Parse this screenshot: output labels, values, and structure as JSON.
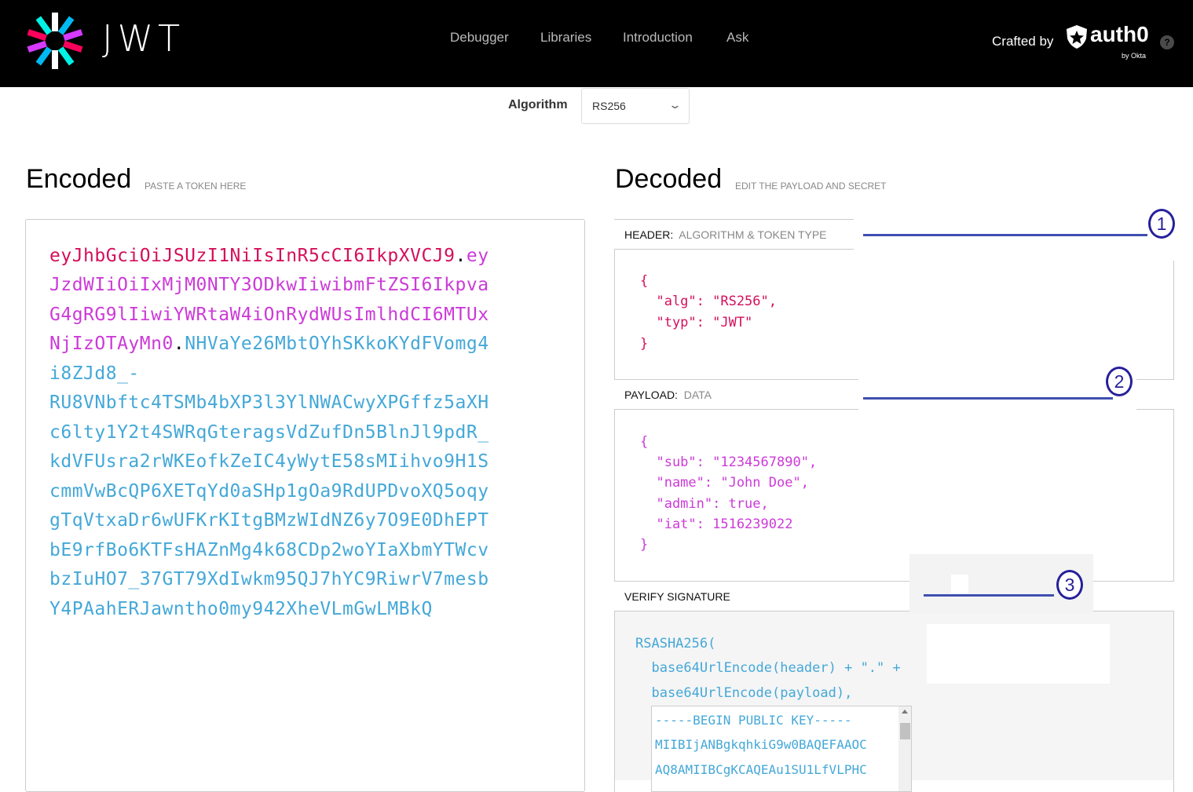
{
  "header": {
    "logo_text": "JWT",
    "nav": [
      "Debugger",
      "Libraries",
      "Introduction",
      "Ask"
    ],
    "crafted_by": "Crafted by",
    "brand_word": "auth0",
    "brand_sub": "by Okta",
    "help": "?"
  },
  "algorithm": {
    "label": "Algorithm",
    "value": "RS256"
  },
  "encoded": {
    "title": "Encoded",
    "subtitle": "PASTE A TOKEN HERE",
    "token_lines": [
      [
        {
          "t": "eyJhbGciOiJSUzI1NiIsInR5cCI6IkpXVCJ9",
          "c": "red"
        },
        {
          "t": ".",
          "c": "dot"
        },
        {
          "t": "ey",
          "c": "pur"
        }
      ],
      [
        {
          "t": "JzdWIiOiIxMjM0NTY3ODkwIiwibmFtZSI6Ikpva",
          "c": "pur"
        }
      ],
      [
        {
          "t": "G4gRG9lIiwiYWRtaW4iOnRydWUsImlhdCI6MTUx",
          "c": "pur"
        }
      ],
      [
        {
          "t": "NjIzOTAyMn0",
          "c": "pur"
        },
        {
          "t": ".",
          "c": "dot"
        },
        {
          "t": "NHVaYe26MbtOYhSKkoKYdFVomg4",
          "c": "blu"
        }
      ],
      [
        {
          "t": "i8ZJd8_-",
          "c": "blu"
        }
      ],
      [
        {
          "t": "RU8VNbftc4TSMb4bXP3l3YlNWACwyXPGffz5aXH",
          "c": "blu"
        }
      ],
      [
        {
          "t": "c6lty1Y2t4SWRqGteragsVdZufDn5BlnJl9pdR_",
          "c": "blu"
        }
      ],
      [
        {
          "t": "kdVFUsra2rWKEofkZeIC4yWytE58sMIihvo9H1S",
          "c": "blu"
        }
      ],
      [
        {
          "t": "cmmVwBcQP6XETqYd0aSHp1gOa9RdUPDvoXQ5oqy",
          "c": "blu"
        }
      ],
      [
        {
          "t": "gTqVtxaDr6wUFKrKItgBMzWIdNZ6y7O9E0DhEPT",
          "c": "blu"
        }
      ],
      [
        {
          "t": "bE9rfBo6KTFsHAZnMg4k68CDp2woYIaXbmYTWcv",
          "c": "blu"
        }
      ],
      [
        {
          "t": "bzIuHO7_37GT79XdIwkm95QJ7hYC9RiwrV7mesb",
          "c": "blu"
        }
      ],
      [
        {
          "t": "Y4PAahERJawntho0my942XheVLmGwLMBkQ",
          "c": "blu"
        }
      ]
    ]
  },
  "decoded": {
    "title": "Decoded",
    "subtitle": "EDIT THE PAYLOAD AND SECRET",
    "header_section": {
      "label": "HEADER:",
      "desc": "ALGORITHM & TOKEN TYPE",
      "json": [
        "{",
        "  \"alg\": \"RS256\",",
        "  \"typ\": \"JWT\"",
        "}"
      ]
    },
    "payload_section": {
      "label": "PAYLOAD:",
      "desc": "DATA",
      "json": [
        "{",
        "  \"sub\": \"1234567890\",",
        "  \"name\": \"John Doe\",",
        "  \"admin\": true,",
        "  \"iat\": 1516239022",
        "}"
      ]
    },
    "verify_section": {
      "label": "VERIFY SIGNATURE",
      "lines": [
        "RSASHA256(",
        "  base64UrlEncode(header) + \".\" +",
        "  base64UrlEncode(payload),"
      ],
      "public_key": [
        "-----BEGIN PUBLIC KEY-----",
        "MIIBIjANBgkqhkiG9w0BAQEFAAOC",
        "AQ8AMIIBCgKCAQEAu1SU1LfVLPHC"
      ]
    }
  },
  "annotations": [
    "1",
    "2",
    "3"
  ],
  "colors": {
    "header_red": "#d50f5a",
    "payload_purple": "#cc3ad8",
    "signature_blue": "#44a8d8",
    "annotation": "#3f4fb0"
  }
}
